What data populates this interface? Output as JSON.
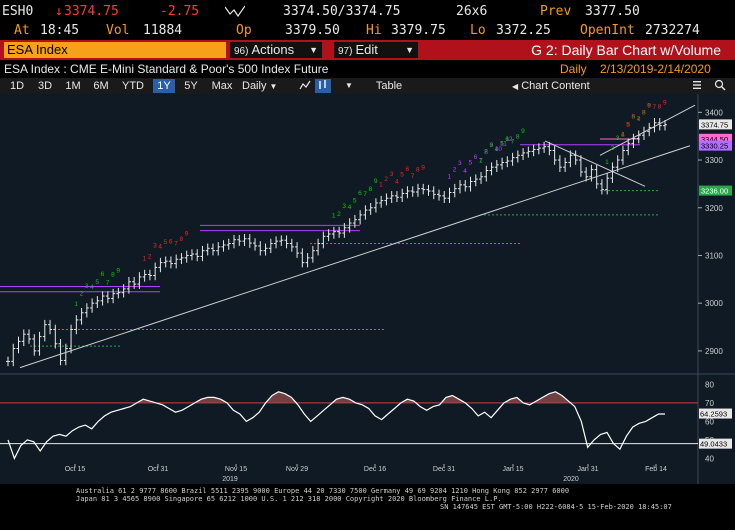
{
  "quote": {
    "ticker": "ESH0",
    "arrow": "↓",
    "last": "3374.75",
    "change": "-2.75",
    "bid_ask": "3374.50/3374.75",
    "size": "26x6",
    "prev_label": "Prev",
    "prev": "3377.50",
    "at_label": "At",
    "time": "18:45",
    "vol_label": "Vol",
    "vol": "11884",
    "op_label": "Op",
    "open": "3379.50",
    "hi_label": "Hi",
    "high": "3379.75",
    "lo_label": "Lo",
    "low": "3372.25",
    "oi_label": "OpenInt",
    "oi": "2732274"
  },
  "header": {
    "security": "ESA Index",
    "actions_num": "96)",
    "actions_label": "Actions",
    "edit_num": "97)",
    "edit_label": "Edit",
    "title": "G 2: Daily Bar Chart w/Volume"
  },
  "subtitle": {
    "description": "ESA Index : CME E-Mini Standard & Poor's 500 Index Future",
    "period": "Daily",
    "range": "2/13/2019-2/14/2020"
  },
  "toolbar": {
    "d1": "1D",
    "d3": "3D",
    "m1": "1M",
    "m6": "6M",
    "ytd": "YTD",
    "y1": "1Y",
    "y5": "5Y",
    "max": "Max",
    "freq": "Daily",
    "table": "Table",
    "chart_content": "Chart Content"
  },
  "chart_data": {
    "type": "bar",
    "price_axis": [
      "3400",
      "3300",
      "3200",
      "3100",
      "3000",
      "2900"
    ],
    "price_ylim": [
      2860,
      3430
    ],
    "price_tags": {
      "last": "3374.75",
      "pink": "3344.50",
      "violet": "3330.25",
      "green": "3236.00"
    },
    "rsi_axis": [
      "80",
      "70",
      "60",
      "50",
      "40"
    ],
    "rsi_ylim": [
      37,
      84
    ],
    "rsi_tags": {
      "last": "64.2593",
      "low": "49.0433"
    },
    "x_ticks": [
      "Oct 15",
      "Oct 31",
      "Nov 15",
      "Nov 29",
      "Dec 16",
      "Dec 31",
      "Jan 15",
      "Jan 31",
      "Feb 14"
    ],
    "year_labels": [
      "2019",
      "2020"
    ],
    "colors": {
      "bar": "#e8e8e8",
      "trend": "#cfcfcf",
      "td_green": "#00d000",
      "td_red": "#ff2020",
      "td_purple": "#c040ff",
      "rsi": "#ffffff",
      "bg": "#0f1a24"
    },
    "close": [
      2878,
      2905,
      2920,
      2935,
      2925,
      2900,
      2930,
      2955,
      2945,
      2915,
      2880,
      2905,
      2945,
      2965,
      2980,
      2990,
      3000,
      3005,
      3015,
      3010,
      3020,
      3022,
      3030,
      3045,
      3040,
      3055,
      3060,
      3058,
      3075,
      3085,
      3088,
      3083,
      3092,
      3095,
      3100,
      3103,
      3098,
      3110,
      3115,
      3110,
      3118,
      3122,
      3125,
      3133,
      3130,
      3135,
      3126,
      3120,
      3110,
      3115,
      3125,
      3130,
      3132,
      3125,
      3118,
      3105,
      3085,
      3095,
      3110,
      3125,
      3140,
      3145,
      3150,
      3147,
      3158,
      3168,
      3175,
      3185,
      3195,
      3200,
      3210,
      3215,
      3220,
      3225,
      3222,
      3230,
      3235,
      3233,
      3240,
      3238,
      3235,
      3228,
      3225,
      3220,
      3232,
      3240,
      3248,
      3244,
      3255,
      3260,
      3265,
      3278,
      3285,
      3290,
      3295,
      3298,
      3305,
      3310,
      3315,
      3318,
      3322,
      3325,
      3328,
      3320,
      3300,
      3285,
      3295,
      3310,
      3300,
      3275,
      3265,
      3280,
      3250,
      3238,
      3262,
      3285,
      3300,
      3320,
      3335,
      3345,
      3352,
      3360,
      3368,
      3378,
      3372,
      3374
    ],
    "rsi": [
      50,
      40,
      47,
      50,
      49,
      44,
      49,
      52,
      53,
      52,
      55,
      57,
      58,
      56,
      60,
      63,
      65,
      66,
      67,
      68,
      70,
      72,
      71,
      70,
      69,
      67,
      65,
      66,
      68,
      70,
      72,
      73,
      73,
      72,
      70,
      66,
      64,
      60,
      62,
      65,
      70,
      74,
      76,
      75,
      73,
      69,
      64,
      60,
      63,
      66,
      69,
      72,
      73,
      72,
      70,
      69,
      67,
      63,
      61,
      64,
      67,
      70,
      72,
      71,
      68,
      66,
      68,
      69,
      73,
      74,
      72,
      70,
      67,
      63,
      65,
      62,
      66,
      70,
      72,
      73,
      70,
      69,
      71,
      73,
      75,
      76,
      74,
      71,
      68,
      60,
      46,
      50,
      53,
      54,
      48,
      45,
      52,
      57,
      59,
      60,
      62,
      64,
      64
    ]
  },
  "footer": {
    "line1": "Australia 61 2 9777 8600 Brazil 5511 2395 9000 Europe 44 20 7330 7500 Germany 49 69 9204 1210 Hong Kong 852 2977 6000",
    "line2": "Japan 81 3 4565 8900       Singapore 65 6212 1000     U.S. 1 212 318 2000          Copyright 2020 Bloomberg Finance L.P.",
    "line3": "SN 147645 EST  GMT-5:00 H222-6084-5 15-Feb-2020 18:45:07"
  }
}
